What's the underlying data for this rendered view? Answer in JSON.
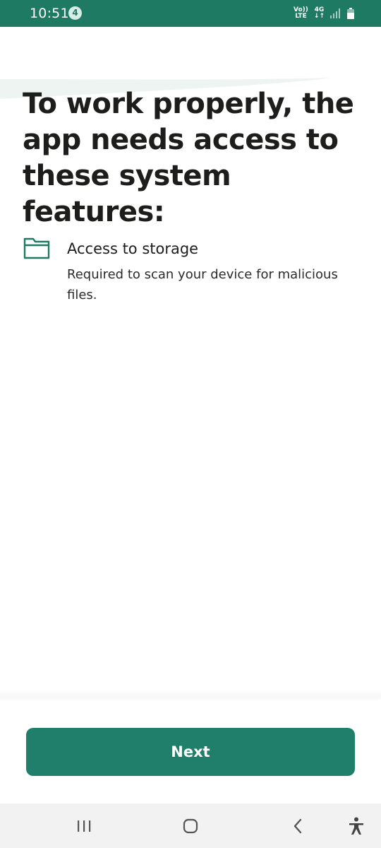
{
  "status_bar": {
    "time": "10:51",
    "notification_count": "4",
    "volte_top": "Vo))",
    "volte_bottom": "LTE",
    "network_top": "4G",
    "network_bottom": "↓↑",
    "icons": [
      "signal-icon",
      "battery-icon"
    ],
    "background_color": "#1f7a63"
  },
  "main": {
    "title": "To work properly, the app needs access to these system features:",
    "permissions": [
      {
        "icon": "folder-icon",
        "title": "Access to storage",
        "description": "Required to scan your device for malicious files."
      }
    ]
  },
  "footer": {
    "next_label": "Next",
    "button_color": "#1f7f6b"
  },
  "nav_bar": {
    "items": [
      "recent-apps-icon",
      "home-icon",
      "back-icon",
      "accessibility-icon"
    ]
  }
}
